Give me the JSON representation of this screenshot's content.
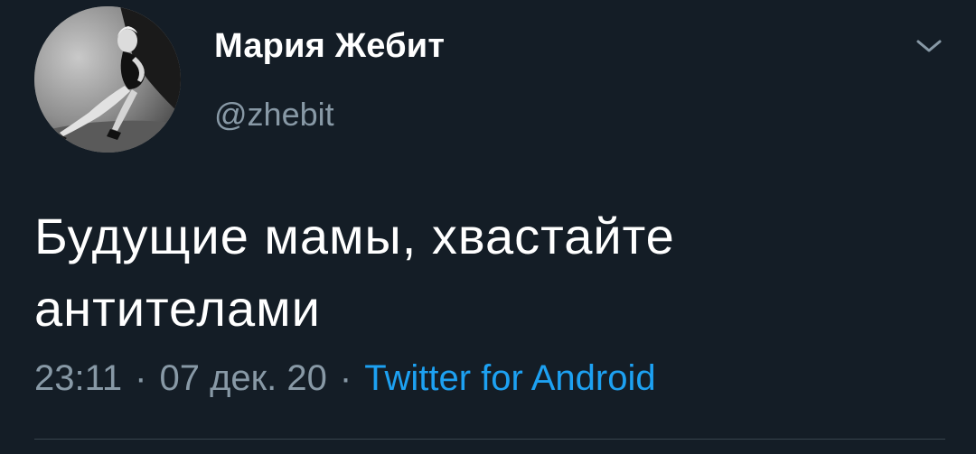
{
  "user": {
    "display_name": "Мария Жебит",
    "handle": "@zhebit"
  },
  "tweet": {
    "text": "Будущие мамы, хвастайте антителами",
    "time": "23:11",
    "date": "07 дек. 20",
    "separator": "·",
    "source": "Twitter for Android"
  },
  "icons": {
    "menu": "chevron-down-icon",
    "avatar": "avatar-photo"
  },
  "colors": {
    "background": "#141d26",
    "text": "#ffffff",
    "secondary_text": "#8899a6",
    "link": "#1da1f2",
    "divider": "#38444d"
  }
}
